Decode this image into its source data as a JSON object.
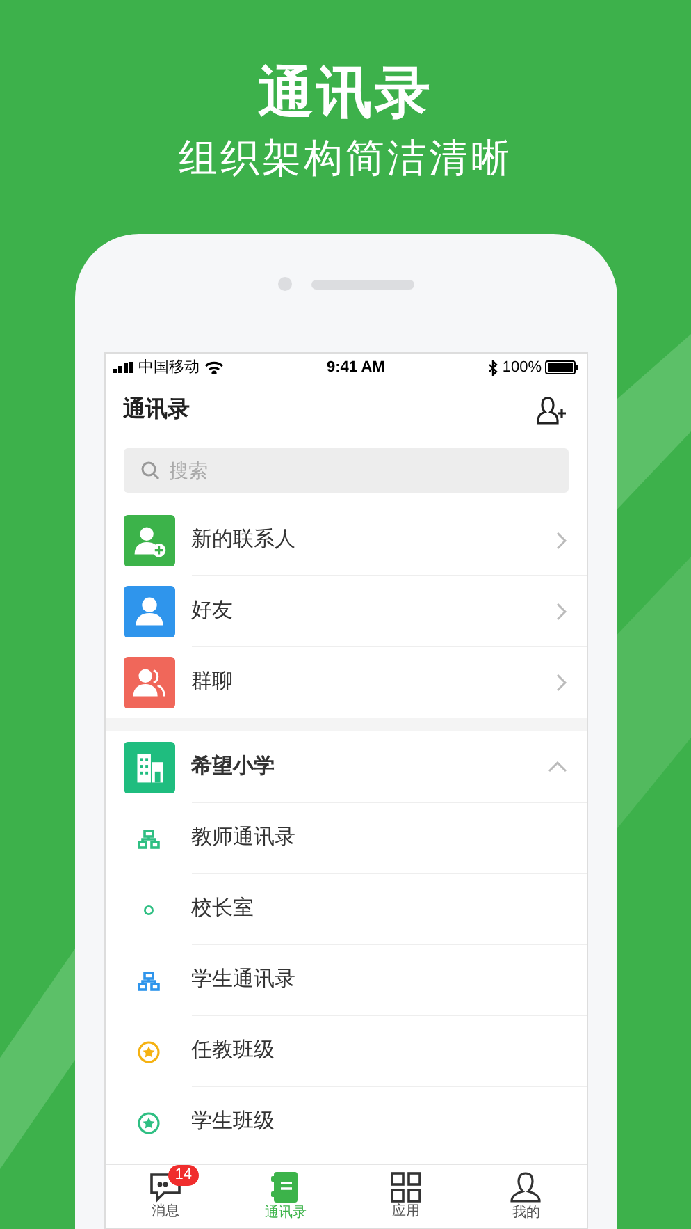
{
  "headline": "通讯录",
  "subheadline": "组织架构简洁清晰",
  "status_bar": {
    "carrier": "中国移动",
    "time": "9:41 AM",
    "battery": "100%"
  },
  "header": {
    "title": "通讯录"
  },
  "search": {
    "placeholder": "搜索"
  },
  "shortcuts": [
    {
      "label": "新的联系人",
      "kind": "new-contact",
      "color": "#3cb34a"
    },
    {
      "label": "好友",
      "kind": "friend",
      "color": "#2f95ec"
    },
    {
      "label": "群聊",
      "kind": "group",
      "color": "#f0675a"
    }
  ],
  "organization": {
    "name": "希望小学",
    "expanded": true,
    "children": [
      {
        "label": "教师通讯录",
        "kind": "tree",
        "color": "#2fbf83"
      },
      {
        "label": "校长室",
        "kind": "dot",
        "color": "#2fbf83"
      },
      {
        "label": "学生通讯录",
        "kind": "tree",
        "color": "#2f95ec"
      },
      {
        "label": "任教班级",
        "kind": "star",
        "color": "#f5b212"
      },
      {
        "label": "学生班级",
        "kind": "star",
        "color": "#2fbf83"
      }
    ]
  },
  "tabs": [
    {
      "label": "消息",
      "kind": "chat",
      "selected": false,
      "badge": "14"
    },
    {
      "label": "通讯录",
      "kind": "book",
      "selected": true
    },
    {
      "label": "应用",
      "kind": "grid",
      "selected": false
    },
    {
      "label": "我的",
      "kind": "user",
      "selected": false
    }
  ]
}
